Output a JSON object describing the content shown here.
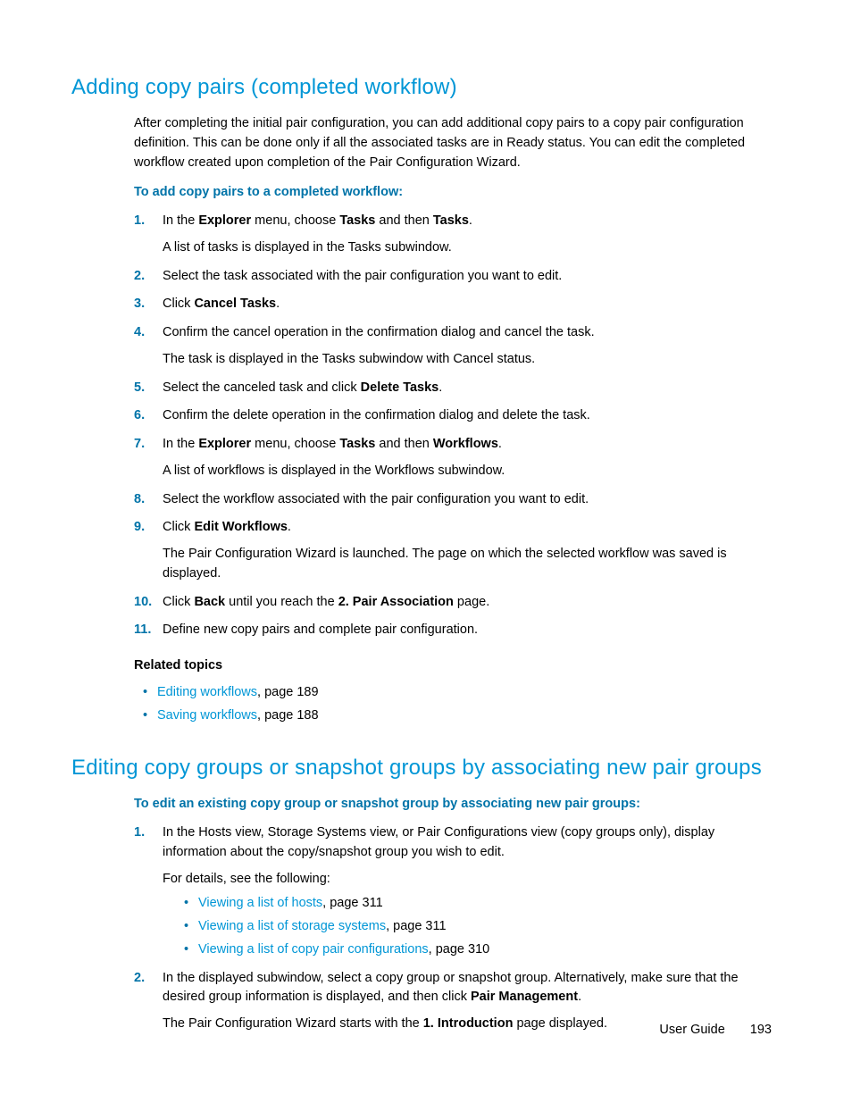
{
  "section1": {
    "title": "Adding copy pairs (completed workflow)",
    "intro": "After completing the initial pair configuration, you can add additional copy pairs to a copy pair configuration definition. This can be done only if all the associated tasks are in Ready status. You can edit the completed workflow created upon completion of the Pair Configuration Wizard.",
    "procHeading": "To add copy pairs to a completed workflow:",
    "steps": {
      "s1a": "In the ",
      "s1b": "Explorer",
      "s1c": " menu, choose ",
      "s1d": "Tasks",
      "s1e": " and then ",
      "s1f": "Tasks",
      "s1g": ".",
      "s1sub": "A list of tasks is displayed in the Tasks subwindow.",
      "s2": "Select the task associated with the pair configuration you want to edit.",
      "s3a": "Click ",
      "s3b": "Cancel Tasks",
      "s3c": ".",
      "s4": "Confirm the cancel operation in the confirmation dialog and cancel the task.",
      "s4sub": "The task is displayed in the Tasks subwindow with Cancel status.",
      "s5a": "Select the canceled task and click ",
      "s5b": "Delete Tasks",
      "s5c": ".",
      "s6": "Confirm the delete operation in the confirmation dialog and delete the task.",
      "s7a": "In the ",
      "s7b": "Explorer",
      "s7c": " menu, choose ",
      "s7d": "Tasks",
      "s7e": " and then ",
      "s7f": "Workflows",
      "s7g": ".",
      "s7sub": "A list of workflows is displayed in the Workflows subwindow.",
      "s8": "Select the workflow associated with the pair configuration you want to edit.",
      "s9a": "Click ",
      "s9b": "Edit Workflows",
      "s9c": ".",
      "s9sub": "The Pair Configuration Wizard is launched. The page on which the selected workflow was saved is displayed.",
      "s10a": "Click ",
      "s10b": "Back",
      "s10c": " until you reach the ",
      "s10d": "2. Pair Association",
      "s10e": " page.",
      "s11": "Define new copy pairs and complete pair configuration."
    },
    "relatedHeading": "Related topics",
    "related": {
      "r1link": "Editing workflows",
      "r1tail": ", page 189",
      "r2link": "Saving workflows",
      "r2tail": ", page 188"
    }
  },
  "section2": {
    "title": "Editing copy groups or snapshot groups by associating new pair groups",
    "procHeading": "To edit an existing copy group or snapshot group by associating new pair groups:",
    "steps": {
      "s1": "In the Hosts view, Storage Systems view, or Pair Configurations view (copy groups only), display information about the copy/snapshot group you wish to edit.",
      "s1sub": "For details, see the following:",
      "s1b1link": "Viewing a list of hosts",
      "s1b1tail": ", page 311",
      "s1b2link": "Viewing a list of storage systems",
      "s1b2tail": ", page 311",
      "s1b3link": "Viewing a list of copy pair configurations",
      "s1b3tail": ", page 310",
      "s2a": "In the displayed subwindow, select a copy group or snapshot group. Alternatively, make sure that the desired group information is displayed, and then click ",
      "s2b": "Pair Management",
      "s2c": ".",
      "s2suba": "The Pair Configuration Wizard starts with the ",
      "s2subb": "1. Introduction",
      "s2subc": " page displayed."
    }
  },
  "footer": {
    "label": "User Guide",
    "page": "193"
  }
}
